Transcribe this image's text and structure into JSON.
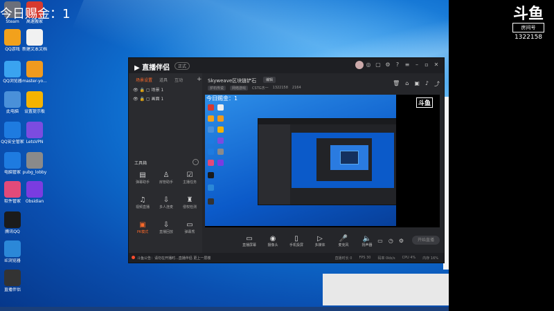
{
  "overlay": {
    "gold_text": "今日赐金：1",
    "douyu_logo": "斗鱼",
    "douyu_sub": "房间号",
    "room_number": "1322158"
  },
  "desktop_icons": [
    {
      "label": "Steam",
      "color": "#6b6f7a"
    },
    {
      "label": "高速搬家",
      "color": "#d63a2f"
    },
    {
      "label": "QQ游戏",
      "color": "#f2a11c"
    },
    {
      "label": "新建文本文档",
      "color": "#f1f1f1"
    },
    {
      "label": "QQ浏览器",
      "color": "#3aa3f0"
    },
    {
      "label": "master-yo...",
      "color": "#f09a1e"
    },
    {
      "label": "此电脑",
      "color": "#4a90d9"
    },
    {
      "label": "设置提示板",
      "color": "#f5b300"
    },
    {
      "label": "QQ安全管家",
      "color": "#1e7be0"
    },
    {
      "label": "LetsVPN",
      "color": "#7b4ce0"
    },
    {
      "label": "电脑管家",
      "color": "#1e7be0"
    },
    {
      "label": "pubg_lobby",
      "color": "#8a8a8a"
    },
    {
      "label": "软件管家",
      "color": "#e24a7a"
    },
    {
      "label": "Obsidian",
      "color": "#7a3ce0"
    },
    {
      "label": "腾讯QQ",
      "color": "#1b1b1b"
    },
    {
      "label": "IE浏览器",
      "color": "#2b88d8"
    },
    {
      "label": "直播伴侣",
      "color": "#333333"
    }
  ],
  "app": {
    "brand": "直播伴侣",
    "version": "正式",
    "scene_tabs": [
      "场景设置",
      "道具",
      "互动"
    ],
    "scenes": [
      "场景 1",
      "画面 1"
    ],
    "tools_title": "工具箱",
    "tools": [
      {
        "label": "弹幕助手",
        "icon": "danmu-icon"
      },
      {
        "label": "房管助手",
        "icon": "admin-icon"
      },
      {
        "label": "主播任务",
        "icon": "task-icon"
      },
      {
        "label": "视频直播",
        "icon": "video-icon"
      },
      {
        "label": "多人连麦",
        "icon": "link-icon"
      },
      {
        "label": "侵权检测",
        "icon": "check-icon"
      },
      {
        "label": "PK模式",
        "icon": "pk-icon"
      },
      {
        "label": "直播回放",
        "icon": "replay-icon"
      },
      {
        "label": "弹幕秀",
        "icon": "tv-icon"
      }
    ],
    "room_title": "Skyweave区块链铲石",
    "room_tag": "编辑",
    "room_meta": [
      "炉石传说",
      "网络游戏",
      "CSTG杰一",
      "1322158",
      "2164"
    ],
    "sources": [
      {
        "label": "直播屏幕",
        "icon": "screen-icon"
      },
      {
        "label": "摄像头",
        "icon": "camera-icon"
      },
      {
        "label": "手机投屏",
        "icon": "phone-icon"
      },
      {
        "label": "多媒体",
        "icon": "media-icon"
      },
      {
        "label": "麦克风",
        "icon": "mic-icon"
      },
      {
        "label": "扬声器",
        "icon": "speaker-icon"
      }
    ],
    "start_button": "开始直播",
    "notice": "斗鱼公告：请勿在开播时...直播伴侣 更上一层楼",
    "stats": [
      "直播时长 0",
      "FPS 30",
      "码率 0kb/s",
      "CPU 4%",
      "内存 16%"
    ]
  }
}
